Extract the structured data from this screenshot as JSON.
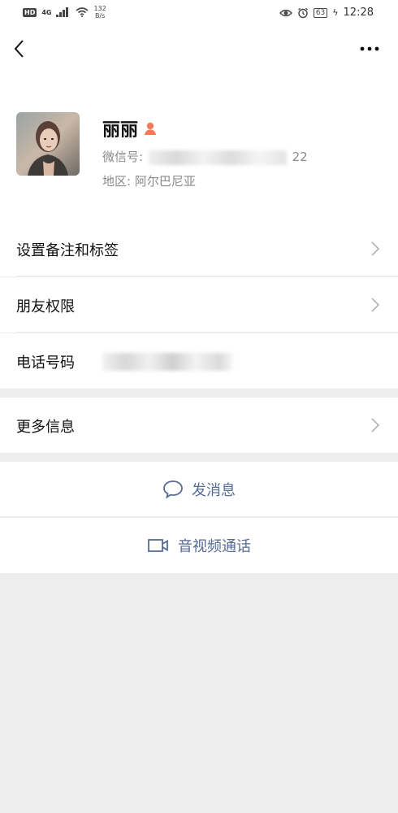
{
  "status_bar": {
    "hd": "HD",
    "network": "4G",
    "speed_value": "132",
    "speed_unit": "B/s",
    "battery": "63",
    "time": "12:28"
  },
  "profile": {
    "name": "丽丽",
    "wechat_id_label": "微信号:",
    "wechat_id_suffix": "22",
    "region": "地区: 阿尔巴尼亚"
  },
  "menu": {
    "remarks_tags": "设置备注和标签",
    "friend_permissions": "朋友权限",
    "phone_label": "电话号码",
    "more_info": "更多信息"
  },
  "actions": {
    "send_message": "发消息",
    "av_call": "音视频通话"
  },
  "colors": {
    "link": "#576b95",
    "gender_icon": "#f37b5c",
    "background": "#ededed"
  },
  "icons": [
    "back-arrow-icon",
    "more-dots-icon",
    "gender-female-icon",
    "chevron-right-icon",
    "chat-bubble-icon",
    "video-camera-icon"
  ]
}
